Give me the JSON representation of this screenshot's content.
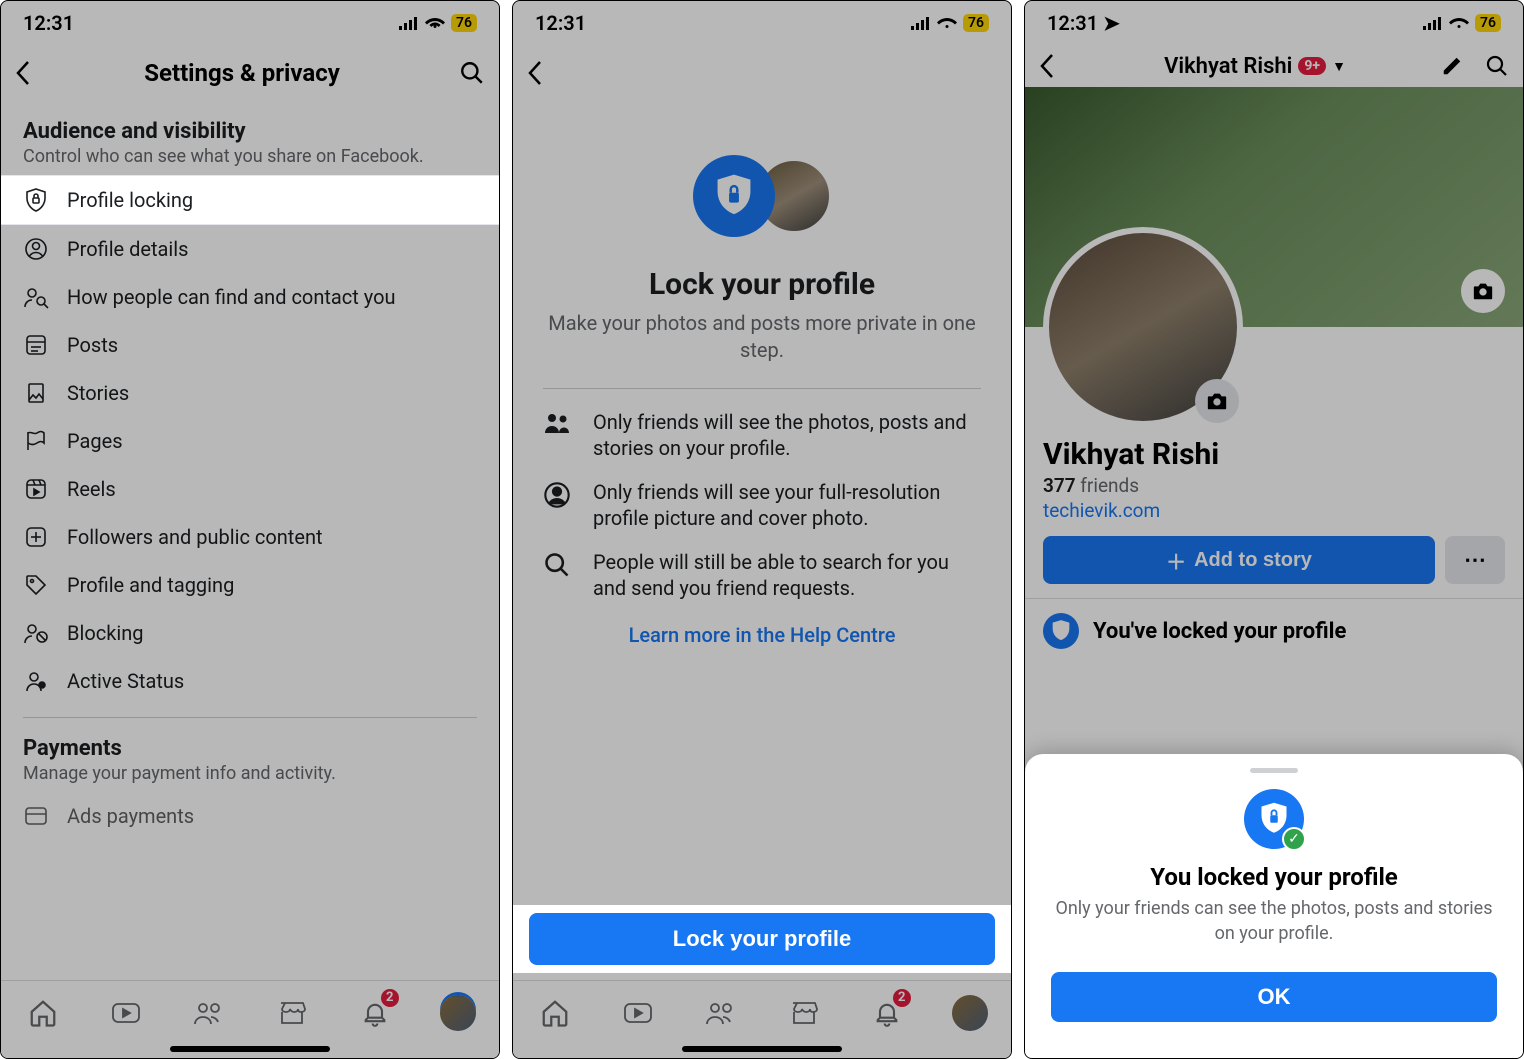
{
  "status": {
    "time": "12:31",
    "battery": "76"
  },
  "screen1": {
    "title": "Settings & privacy",
    "section_title": "Audience and visibility",
    "section_sub": "Control who can see what you share on Facebook.",
    "items": [
      {
        "label": "Profile locking"
      },
      {
        "label": "Profile details"
      },
      {
        "label": "How people can find and contact you"
      },
      {
        "label": "Posts"
      },
      {
        "label": "Stories"
      },
      {
        "label": "Pages"
      },
      {
        "label": "Reels"
      },
      {
        "label": "Followers and public content"
      },
      {
        "label": "Profile and tagging"
      },
      {
        "label": "Blocking"
      },
      {
        "label": "Active Status"
      }
    ],
    "payments_title": "Payments",
    "payments_sub": "Manage your payment info and activity.",
    "payments_item": "Ads payments",
    "notif_badge": "2"
  },
  "screen2": {
    "title": "Lock your profile",
    "sub": "Make your photos and posts more private in one step.",
    "info1": "Only friends will see the photos, posts and stories on your profile.",
    "info2": "Only friends will see your full-resolution profile picture and cover photo.",
    "info3": "People will still be able to search for you and send you friend requests.",
    "learn": "Learn more in the Help Centre",
    "button": "Lock your profile",
    "notif_badge": "2"
  },
  "screen3": {
    "header_name": "Vikhyat Rishi",
    "header_badge": "9+",
    "name": "Vikhyat Rishi",
    "friends_count": "377",
    "friends_label": "friends",
    "website": "techievik.com",
    "add_story": "Add to story",
    "banner": "You've locked your profile",
    "sheet_title": "You locked your profile",
    "sheet_sub": "Only your friends can see the photos, posts and stories on your profile.",
    "ok": "OK"
  }
}
